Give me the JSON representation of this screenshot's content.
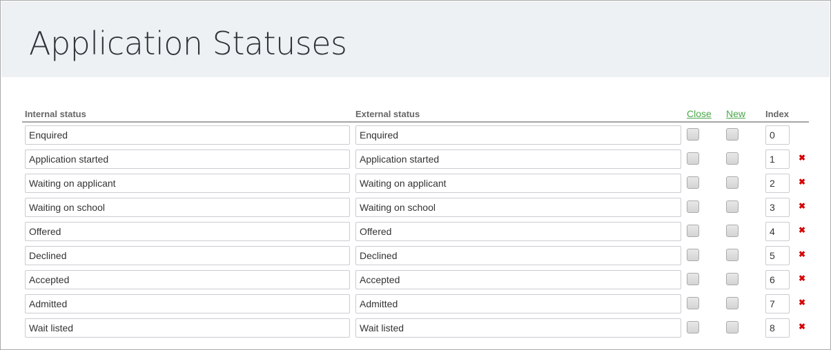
{
  "header": {
    "title": "Application Statuses"
  },
  "columns": {
    "internal": "Internal status",
    "external": "External status",
    "close": "Close",
    "new": "New",
    "index": "Index"
  },
  "rows": [
    {
      "internal": "Enquired",
      "external": "Enquired",
      "close": false,
      "new": false,
      "index": "0",
      "deletable": false
    },
    {
      "internal": "Application started",
      "external": "Application started",
      "close": false,
      "new": false,
      "index": "1",
      "deletable": true
    },
    {
      "internal": "Waiting on applicant",
      "external": "Waiting on applicant",
      "close": false,
      "new": false,
      "index": "2",
      "deletable": true
    },
    {
      "internal": "Waiting on school",
      "external": "Waiting on school",
      "close": false,
      "new": false,
      "index": "3",
      "deletable": true
    },
    {
      "internal": "Offered",
      "external": "Offered",
      "close": false,
      "new": false,
      "index": "4",
      "deletable": true
    },
    {
      "internal": "Declined",
      "external": "Declined",
      "close": false,
      "new": false,
      "index": "5",
      "deletable": true
    },
    {
      "internal": "Accepted",
      "external": "Accepted",
      "close": false,
      "new": false,
      "index": "6",
      "deletable": true
    },
    {
      "internal": "Admitted",
      "external": "Admitted",
      "close": false,
      "new": false,
      "index": "7",
      "deletable": true
    },
    {
      "internal": "Wait listed",
      "external": "Wait listed",
      "close": false,
      "new": false,
      "index": "8",
      "deletable": true
    }
  ],
  "icons": {
    "delete": "✖"
  },
  "colors": {
    "link": "#4aa74a",
    "delete": "#d40000",
    "header_bg": "#edf1f4"
  }
}
